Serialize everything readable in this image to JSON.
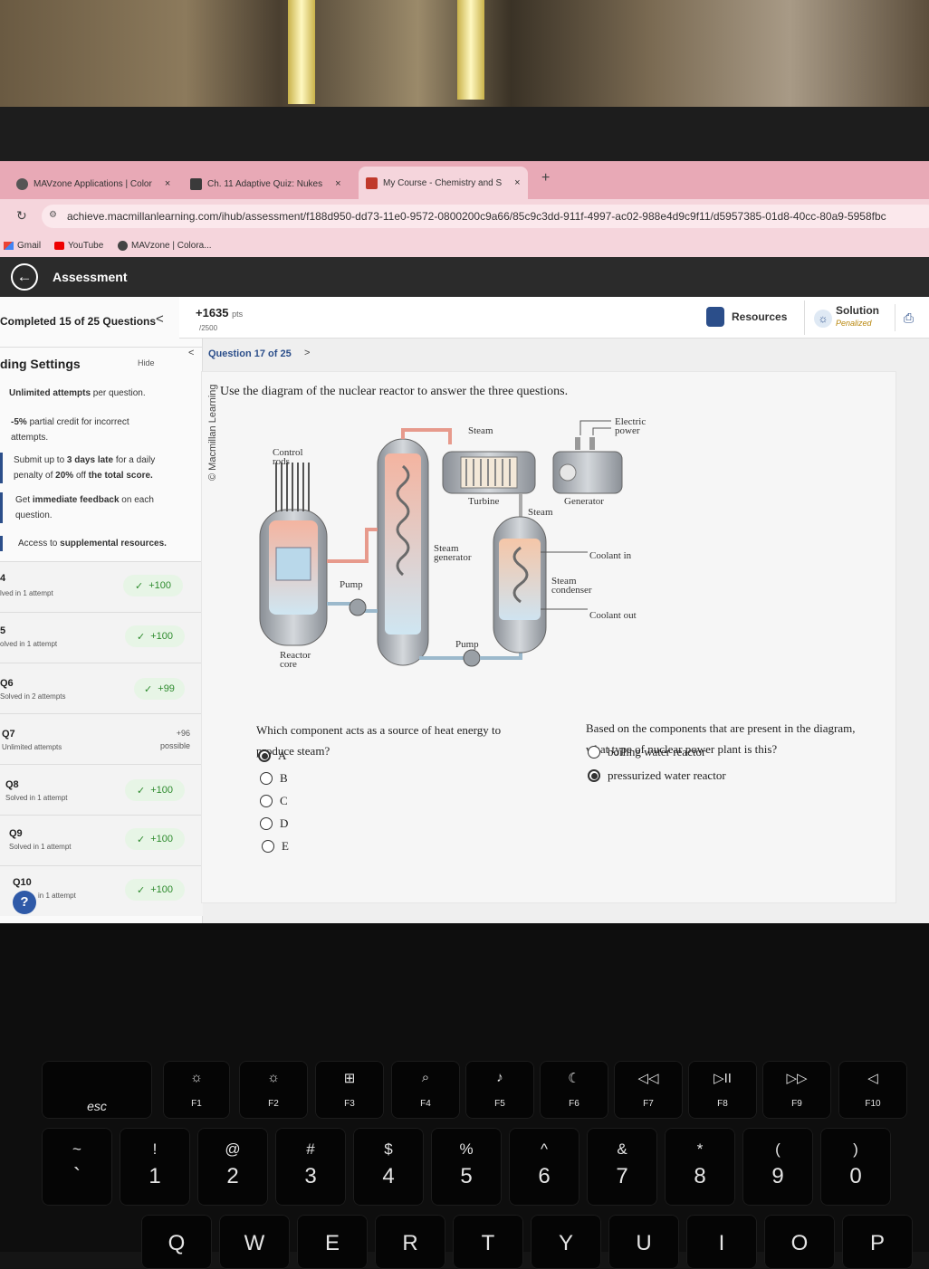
{
  "browser": {
    "tabs": [
      {
        "title": "MAVzone Applications | Color",
        "close": "×"
      },
      {
        "title": "Ch. 11 Adaptive Quiz: Nukes",
        "close": "×"
      },
      {
        "title": "My Course - Chemistry and S",
        "close": "×"
      }
    ],
    "new_tab": "+",
    "url": "achieve.macmillanlearning.com/ihub/assessment/f188d950-dd73-11e0-9572-0800200c9a66/85c9c3dd-911f-4997-ac02-988e4d9c9f11/d5957385-01d8-40cc-80a9-5958fbc",
    "bookmarks": [
      "Gmail",
      "YouTube",
      "MAVzone | Colora..."
    ]
  },
  "app": {
    "title": "Assessment",
    "back": "←"
  },
  "sidebar": {
    "completed": "Completed 15 of 25 Questions",
    "collapse": "<",
    "settings_title": "ding Settings",
    "hide": "Hide",
    "settings": [
      {
        "bold": "Unlimited attempts",
        "text": " per question."
      },
      {
        "bold": "-5%",
        "text": " partial credit for incorrect attempts."
      },
      {
        "text1": "Submit up to ",
        "bold1": "3 days late",
        "text2": " for a daily penalty of ",
        "bold2": "20%",
        "text3": " off ",
        "bold3": "the total score."
      },
      {
        "text1": "Get ",
        "bold": "immediate feedback",
        "text2": " on each question."
      },
      {
        "text": "Access to ",
        "bold": "supplemental resources."
      }
    ],
    "questions": [
      {
        "num": "4",
        "status": "lved in 1 attempt",
        "score": "+100",
        "check": "✓"
      },
      {
        "num": "5",
        "status": "olved in 1 attempt",
        "score": "+100",
        "check": "✓"
      },
      {
        "num": "Q6",
        "status": "Solved in 2 attempts",
        "score": "+99",
        "check": "✓"
      },
      {
        "num": "Q7",
        "status": "Unlimited attempts",
        "score": "+96",
        "possible": "possible"
      },
      {
        "num": "Q8",
        "status": "Solved in 1 attempt",
        "score": "+100",
        "check": "✓"
      },
      {
        "num": "Q9",
        "status": "Solved in 1 attempt",
        "score": "+100",
        "check": "✓"
      },
      {
        "num": "Q10",
        "status": "in 1 attempt",
        "score": "+100",
        "check": "✓"
      }
    ],
    "help": "?"
  },
  "header": {
    "points": "+1635",
    "points_unit": "pts",
    "points_total": "/2500",
    "resources": "Resources",
    "solution": "Solution",
    "solution_status": "Penalized"
  },
  "question_nav": {
    "prev": "<",
    "label": "Question 17 of 25",
    "next": ">"
  },
  "question": {
    "credit": "© Macmillan Learning",
    "prompt": "Use the diagram of the nuclear reactor to answer the three questions.",
    "diagram_labels": {
      "steam_top": "Steam",
      "electric_power": "Electric power",
      "control_rods": "Control rods",
      "turbine": "Turbine",
      "generator": "Generator",
      "steam_mid": "Steam",
      "steam_generator": "Steam generator",
      "coolant_in": "Coolant in",
      "pump_left": "Pump",
      "steam_condenser": "Steam condenser",
      "coolant_out": "Coolant out",
      "pump_bottom": "Pump",
      "reactor_core": "Reactor core"
    },
    "part1": {
      "text": "Which component acts as a source of heat energy to produce steam?",
      "options": [
        "A",
        "B",
        "C",
        "D",
        "E"
      ],
      "selected": "A"
    },
    "part2": {
      "text": "Based on the components that are present in the diagram, what type of nuclear power plant is this?",
      "options": [
        "boiling water reactor",
        "pressurized water reactor"
      ],
      "selected": "pressurized water reactor"
    }
  },
  "keyboard": {
    "fn_row": [
      {
        "label": "esc"
      },
      {
        "icon": "☼",
        "label": "F1"
      },
      {
        "icon": "☼",
        "label": "F2"
      },
      {
        "icon": "⊞",
        "label": "F3"
      },
      {
        "icon": "⌕",
        "label": "F4"
      },
      {
        "icon": "♪",
        "label": "F5"
      },
      {
        "icon": "☾",
        "label": "F6"
      },
      {
        "icon": "◁◁",
        "label": "F7"
      },
      {
        "icon": "▷II",
        "label": "F8"
      },
      {
        "icon": "▷▷",
        "label": "F9"
      },
      {
        "icon": "◁",
        "label": "F10"
      }
    ],
    "num_row": [
      {
        "top": "~",
        "bot": "`"
      },
      {
        "top": "!",
        "bot": "1"
      },
      {
        "top": "@",
        "bot": "2"
      },
      {
        "top": "#",
        "bot": "3"
      },
      {
        "top": "$",
        "bot": "4"
      },
      {
        "top": "%",
        "bot": "5"
      },
      {
        "top": "^",
        "bot": "6"
      },
      {
        "top": "&",
        "bot": "7"
      },
      {
        "top": "*",
        "bot": "8"
      },
      {
        "top": "(",
        "bot": "9"
      },
      {
        "top": ")",
        "bot": "0"
      }
    ],
    "letter_row": [
      "Q",
      "W",
      "E",
      "R",
      "T",
      "Y",
      "U",
      "I",
      "O",
      "P"
    ]
  }
}
